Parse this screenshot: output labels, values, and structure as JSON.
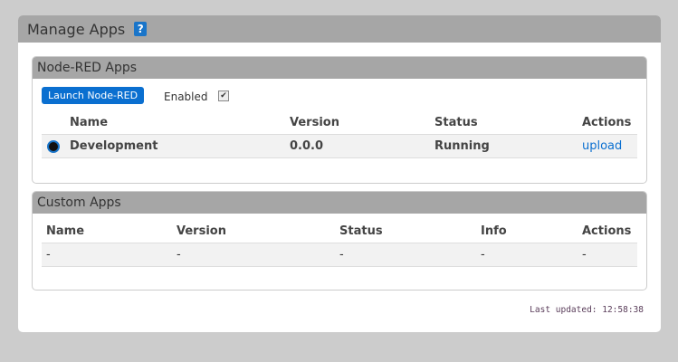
{
  "title": "Manage Apps",
  "help_icon": "?",
  "node_red": {
    "title": "Node-RED Apps",
    "launch_label": "Launch Node-RED",
    "enabled_label": "Enabled",
    "enabled": true,
    "columns": [
      "Name",
      "Version",
      "Status",
      "Actions"
    ],
    "rows": [
      {
        "name": "Development",
        "version": "0.0.0",
        "status": "Running",
        "action": "upload",
        "selected": true
      }
    ]
  },
  "custom": {
    "title": "Custom Apps",
    "columns": [
      "Name",
      "Version",
      "Status",
      "Info",
      "Actions"
    ],
    "rows": [
      {
        "name": "-",
        "version": "-",
        "status": "-",
        "info": "-",
        "actions": "-"
      }
    ]
  },
  "last_updated": "Last updated: 12:58:38"
}
